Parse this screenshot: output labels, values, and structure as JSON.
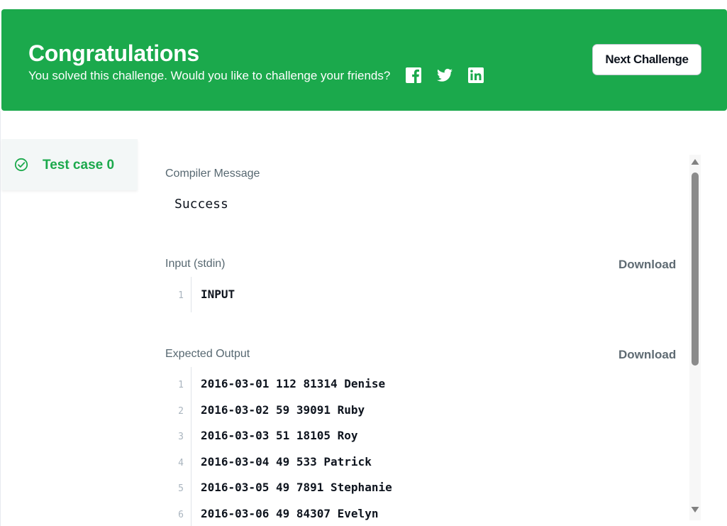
{
  "banner": {
    "title": "Congratulations",
    "subtitle": "You solved this challenge. Would you like to challenge your friends?",
    "social_icons": [
      "facebook-icon",
      "twitter-icon",
      "linkedin-icon"
    ],
    "next_button": "Next Challenge",
    "bg_color": "#1ba94c"
  },
  "testcase_tab": {
    "label": "Test case 0",
    "icon": "check-circle-icon",
    "color": "#1ba94c"
  },
  "compiler": {
    "label": "Compiler Message",
    "message": "Success"
  },
  "input": {
    "label": "Input (stdin)",
    "download": "Download",
    "lines": [
      {
        "n": "1",
        "text": "INPUT"
      }
    ]
  },
  "expected": {
    "label": "Expected Output",
    "download": "Download",
    "lines": [
      {
        "n": "1",
        "text": "2016-03-01 112 81314 Denise"
      },
      {
        "n": "2",
        "text": "2016-03-02 59 39091 Ruby"
      },
      {
        "n": "3",
        "text": "2016-03-03 51 18105 Roy"
      },
      {
        "n": "4",
        "text": "2016-03-04 49 533 Patrick"
      },
      {
        "n": "5",
        "text": "2016-03-05 49 7891 Stephanie"
      },
      {
        "n": "6",
        "text": "2016-03-06 49 84307 Evelyn"
      }
    ]
  }
}
